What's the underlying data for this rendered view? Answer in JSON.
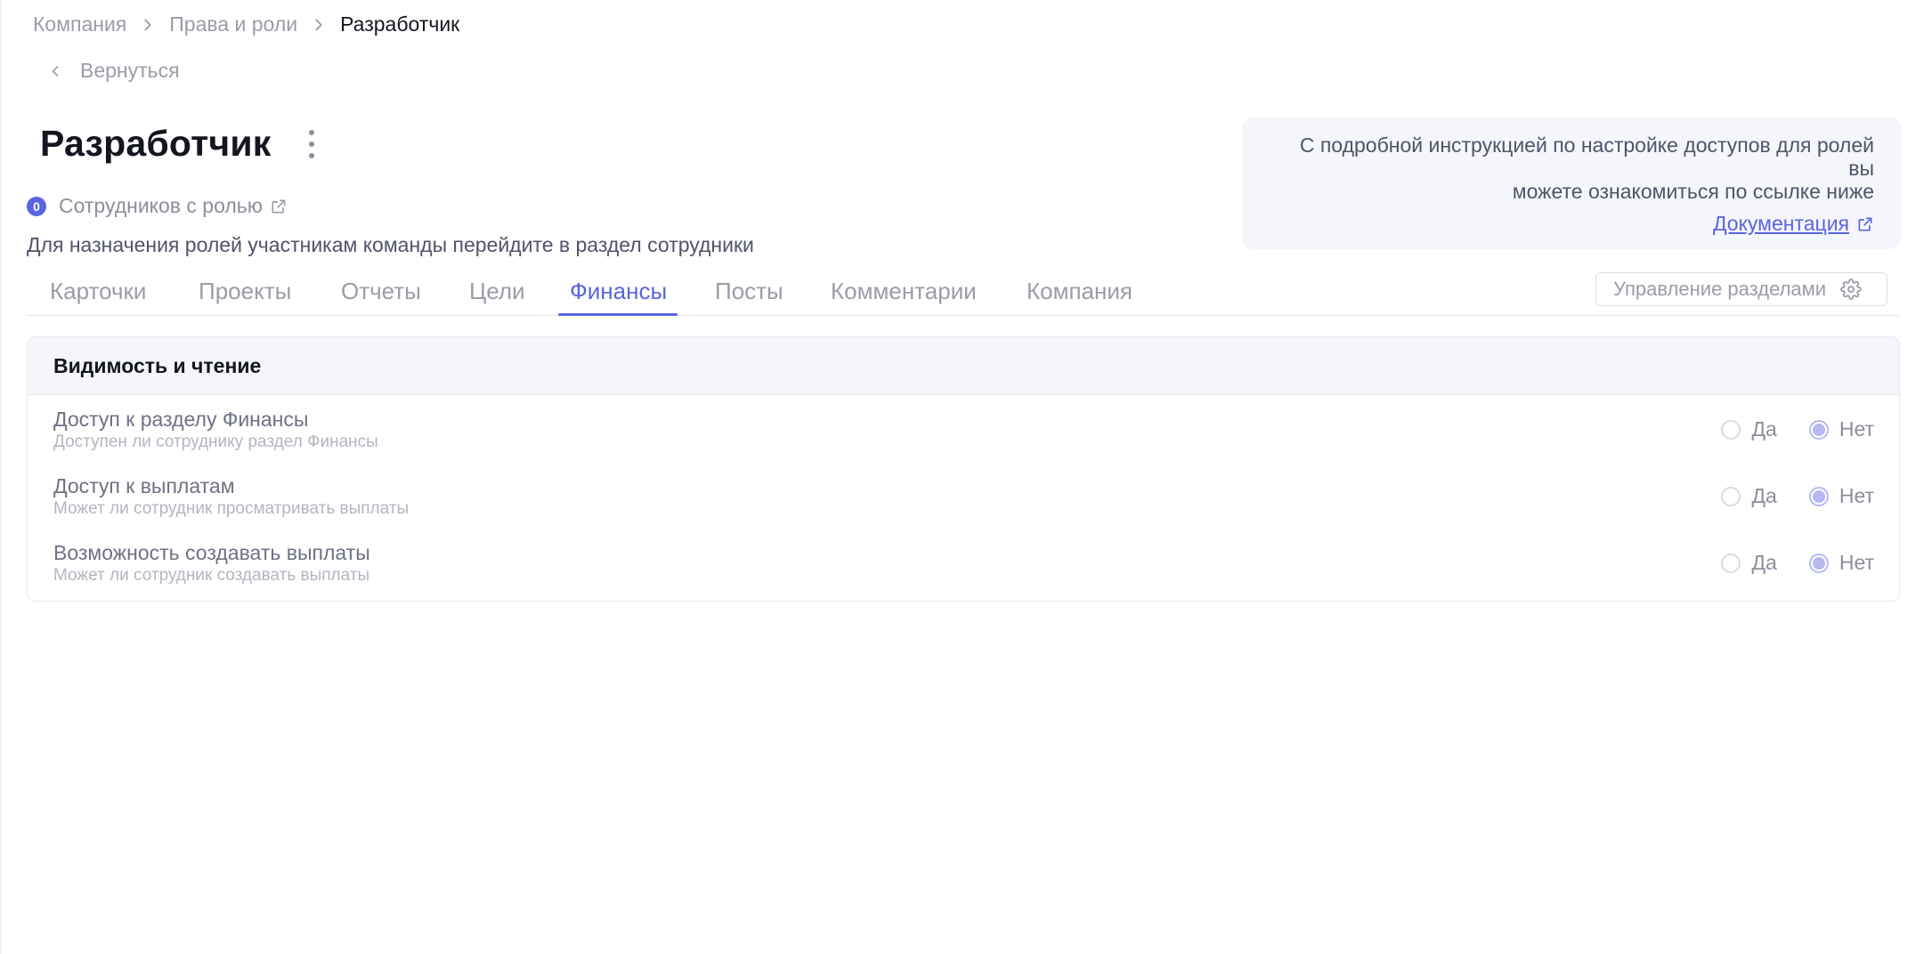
{
  "breadcrumb": {
    "items": [
      "Компания",
      "Права и роли",
      "Разработчик"
    ]
  },
  "back": {
    "label": "Вернуться"
  },
  "role": {
    "title": "Разработчик",
    "employees_count": "0",
    "employees_label": "Сотрудников с ролью",
    "hint": "Для назначения ролей участникам команды перейдите в раздел сотрудники"
  },
  "info": {
    "line1": "С подробной инструкцией по настройке доступов для ролей вы",
    "line2": "можете ознакомиться по ссылке ниже",
    "link_label": "Документация"
  },
  "tabs": [
    {
      "label": "Карточки",
      "active": false
    },
    {
      "label": "Проекты",
      "active": false
    },
    {
      "label": "Отчеты",
      "active": false
    },
    {
      "label": "Цели",
      "active": false
    },
    {
      "label": "Финансы",
      "active": true
    },
    {
      "label": "Посты",
      "active": false
    },
    {
      "label": "Комментарии",
      "active": false
    },
    {
      "label": "Компания",
      "active": false
    }
  ],
  "manage_sections": {
    "label": "Управление разделами"
  },
  "panel": {
    "header": "Видимость и чтение",
    "yes_label": "Да",
    "no_label": "Нет",
    "rows": [
      {
        "title": "Доступ к разделу Финансы",
        "desc": "Доступен ли сотруднику раздел Финансы",
        "value": "Нет"
      },
      {
        "title": "Доступ к выплатам",
        "desc": "Может ли сотрудник просматривать выплаты",
        "value": "Нет"
      },
      {
        "title": "Возможность создавать выплаты",
        "desc": "Может ли сотрудник создавать выплаты",
        "value": "Нет"
      }
    ]
  },
  "colors": {
    "accent": "#5a64e0",
    "radio_checked": "#b6baf0",
    "info_bg": "#f5f6fb"
  }
}
